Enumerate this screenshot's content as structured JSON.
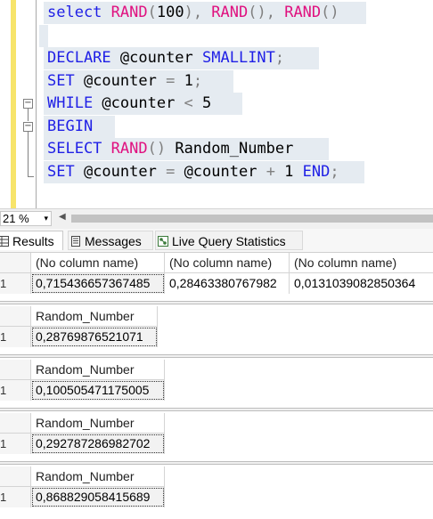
{
  "editor": {
    "lines": [
      [
        {
          "t": "select ",
          "c": "kw"
        },
        {
          "t": "RAND",
          "c": "fn"
        },
        {
          "t": "(",
          "c": "op"
        },
        {
          "t": "100",
          "c": ""
        },
        {
          "t": "), ",
          "c": "op"
        },
        {
          "t": "RAND",
          "c": "fn"
        },
        {
          "t": "(), ",
          "c": "op"
        },
        {
          "t": "RAND",
          "c": "fn"
        },
        {
          "t": "()",
          "c": "op"
        }
      ],
      [],
      [
        {
          "t": "DECLARE ",
          "c": "kw"
        },
        {
          "t": "@counter ",
          "c": ""
        },
        {
          "t": "SMALLINT",
          "c": "kw"
        },
        {
          "t": ";",
          "c": "op"
        }
      ],
      [
        {
          "t": "SET ",
          "c": "kw"
        },
        {
          "t": "@counter ",
          "c": ""
        },
        {
          "t": "= ",
          "c": "op"
        },
        {
          "t": "1",
          "c": ""
        },
        {
          "t": ";",
          "c": "op"
        }
      ],
      [
        {
          "t": "WHILE ",
          "c": "kw"
        },
        {
          "t": "@counter ",
          "c": ""
        },
        {
          "t": "< ",
          "c": "op"
        },
        {
          "t": "5",
          "c": ""
        }
      ],
      [
        {
          "t": "BEGIN",
          "c": "kw"
        }
      ],
      [
        {
          "t": "SELECT ",
          "c": "kw"
        },
        {
          "t": "RAND",
          "c": "fn"
        },
        {
          "t": "() ",
          "c": "op"
        },
        {
          "t": "Random_Number",
          "c": ""
        }
      ],
      [
        {
          "t": "SET ",
          "c": "kw"
        },
        {
          "t": "@counter ",
          "c": ""
        },
        {
          "t": "= ",
          "c": "op"
        },
        {
          "t": "@counter ",
          "c": ""
        },
        {
          "t": "+ ",
          "c": "op"
        },
        {
          "t": "1 ",
          "c": ""
        },
        {
          "t": "END",
          "c": "kw"
        },
        {
          "t": ";",
          "c": "op"
        }
      ]
    ]
  },
  "zoom": {
    "value": "21 %",
    "arrow": "▾"
  },
  "tabs": {
    "results": {
      "label": "Results",
      "icon": "grid-icon"
    },
    "messages": {
      "label": "Messages",
      "icon": "messages-icon"
    },
    "live": {
      "label": "Live Query Statistics",
      "icon": "live-stats-icon"
    }
  },
  "grid1": {
    "headers": [
      "(No column name)",
      "(No column name)",
      "(No column name)"
    ],
    "row_number": "1",
    "values": [
      "0,715436657367485",
      "0,28463380767982",
      "0,0131039082850364"
    ]
  },
  "grids": [
    {
      "header": "Random_Number",
      "row_number": "1",
      "value": "0,28769876521071"
    },
    {
      "header": "Random_Number",
      "row_number": "1",
      "value": "0,100505471175005"
    },
    {
      "header": "Random_Number",
      "row_number": "1",
      "value": "0,292787286982702"
    },
    {
      "header": "Random_Number",
      "row_number": "1",
      "value": "0,868829058415689"
    }
  ],
  "colors": {
    "keyword": "#1f1fe6",
    "function": "#e0107f",
    "gutter": "#f7e46a",
    "selection": "#e5ebf1"
  }
}
